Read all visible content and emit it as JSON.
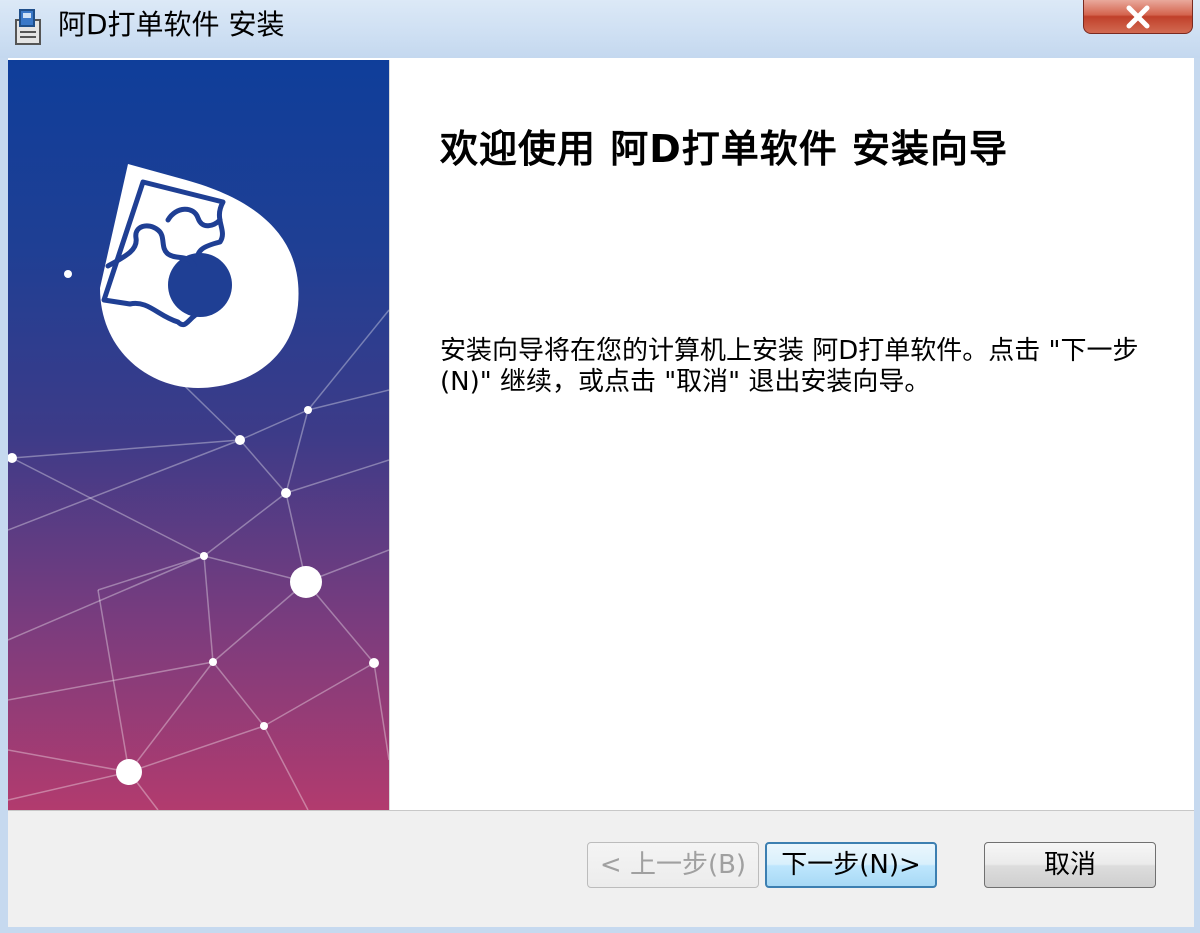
{
  "window": {
    "title": "阿D打单软件 安装",
    "close_symbol": "✕"
  },
  "content": {
    "heading": "欢迎使用  阿D打单软件  安装向导",
    "body": "安装向导将在您的计算机上安装 阿D打单软件。点击 \"下一步(N)\" 继续，或点击 \"取消\" 退出安装向导。"
  },
  "buttons": {
    "back_label": "< 上一步(B)",
    "next_label": "下一步(N)>",
    "cancel_label": "取消"
  },
  "colors": {
    "banner_top": "#0f3e9a",
    "banner_bottom": "#b23b6e",
    "close_button": "#c0402a",
    "default_button_border": "#3c7fb1"
  },
  "icons": {
    "app_icon": "installer-icon",
    "close": "close-icon",
    "logo": "puzzle-logo-icon"
  }
}
